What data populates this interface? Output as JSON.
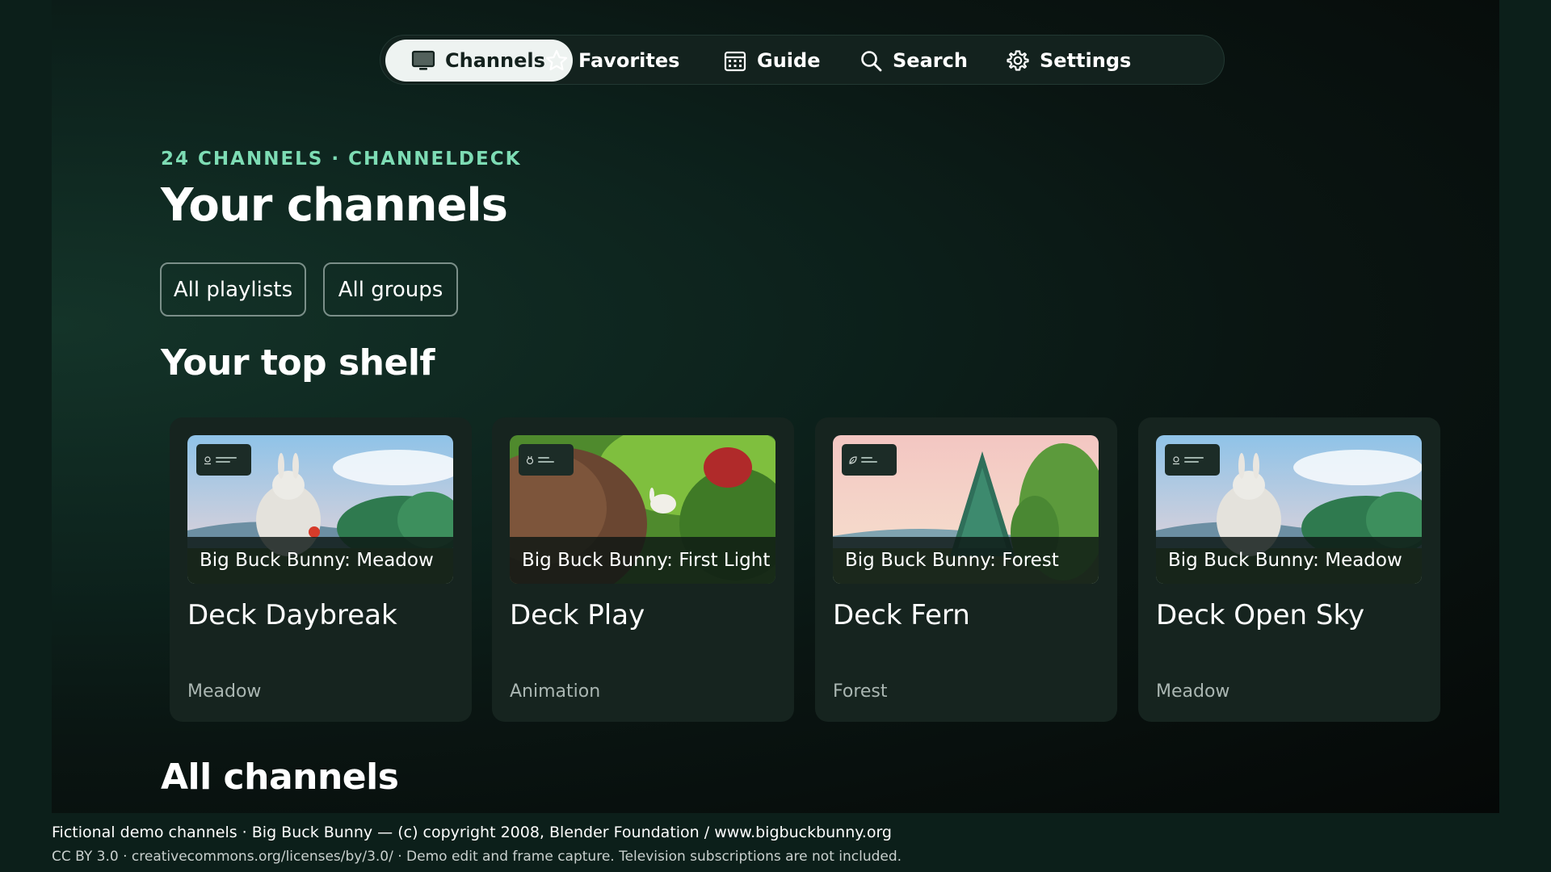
{
  "nav": {
    "items": [
      {
        "label": "Channels",
        "icon": "tv-icon",
        "active": true
      },
      {
        "label": "Favorites",
        "icon": "star-icon",
        "active": false
      },
      {
        "label": "Guide",
        "icon": "calendar-icon",
        "active": false
      },
      {
        "label": "Search",
        "icon": "search-icon",
        "active": false
      },
      {
        "label": "Settings",
        "icon": "gear-icon",
        "active": false
      }
    ]
  },
  "header": {
    "eyebrow": "24 CHANNELS · CHANNELDECK",
    "title": "Your channels"
  },
  "filters": {
    "playlists": "All playlists",
    "groups": "All groups"
  },
  "top_shelf": {
    "heading": "Your top shelf",
    "cards": [
      {
        "name": "Deck Daybreak",
        "now_playing": "Big Buck Bunny: Meadow",
        "group": "Meadow",
        "badge_icon": "channel-logo-icon"
      },
      {
        "name": "Deck Play",
        "now_playing": "Big Buck Bunny: First Light",
        "group": "Animation",
        "badge_icon": "channel-logo-icon"
      },
      {
        "name": "Deck Fern",
        "now_playing": "Big Buck Bunny: Forest",
        "group": "Forest",
        "badge_icon": "leaf-icon"
      },
      {
        "name": "Deck Open Sky",
        "now_playing": "Big Buck Bunny: Meadow",
        "group": "Meadow",
        "badge_icon": "channel-logo-icon"
      }
    ]
  },
  "all_channels": {
    "heading": "All channels"
  },
  "footer": {
    "line1": "Fictional demo channels · Big Buck Bunny — (c) copyright 2008, Blender Foundation / www.bigbuckbunny.org",
    "line2": "CC BY 3.0 · creativecommons.org/licenses/by/3.0/ · Demo edit and frame capture. Television subscriptions are not included."
  },
  "colors": {
    "accent": "#7ddcb4",
    "background": "#0c1f1a",
    "card": "#16241f",
    "nav_active": "#eef3f1"
  }
}
